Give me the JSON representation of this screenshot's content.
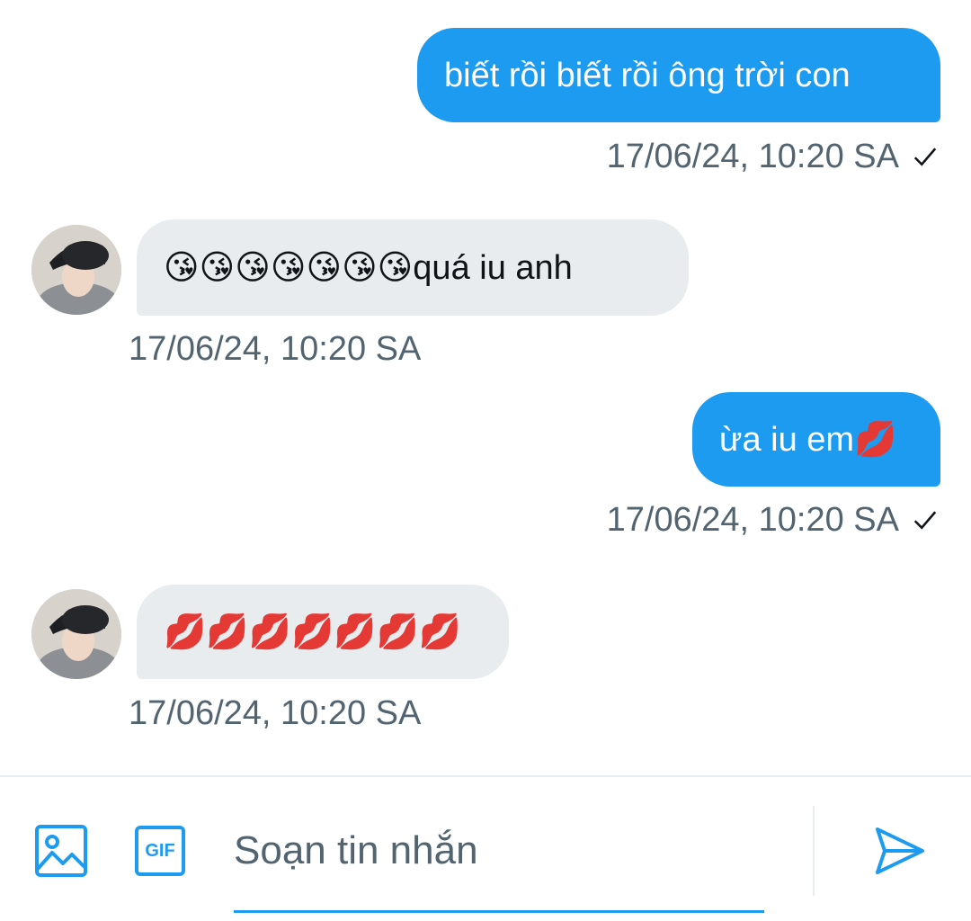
{
  "messages": [
    {
      "direction": "sent",
      "text": "biết rồi biết rồi ông trời con",
      "timestamp": "17/06/24, 10:20 SA",
      "read_icon": "check-icon"
    },
    {
      "direction": "received",
      "text": "😘😘😘😘😘😘😘quá iu anh",
      "timestamp": "17/06/24, 10:20 SA"
    },
    {
      "direction": "sent",
      "text": "ừa iu em💋",
      "timestamp": "17/06/24, 10:20 SA",
      "read_icon": "check-icon"
    },
    {
      "direction": "received",
      "text": "💋💋💋💋💋💋💋",
      "timestamp": "17/06/24, 10:20 SA"
    }
  ],
  "composer": {
    "placeholder": "Soạn tin nhắn",
    "value": "",
    "media_icon": "image-icon",
    "gif_label": "GIF",
    "send_icon": "send-icon"
  },
  "colors": {
    "accent": "#1d9bf0",
    "sent_bubble": "#1d9bf0",
    "received_bubble": "#e9ecef",
    "timestamp": "#536471",
    "divider": "#e6ecf0"
  }
}
